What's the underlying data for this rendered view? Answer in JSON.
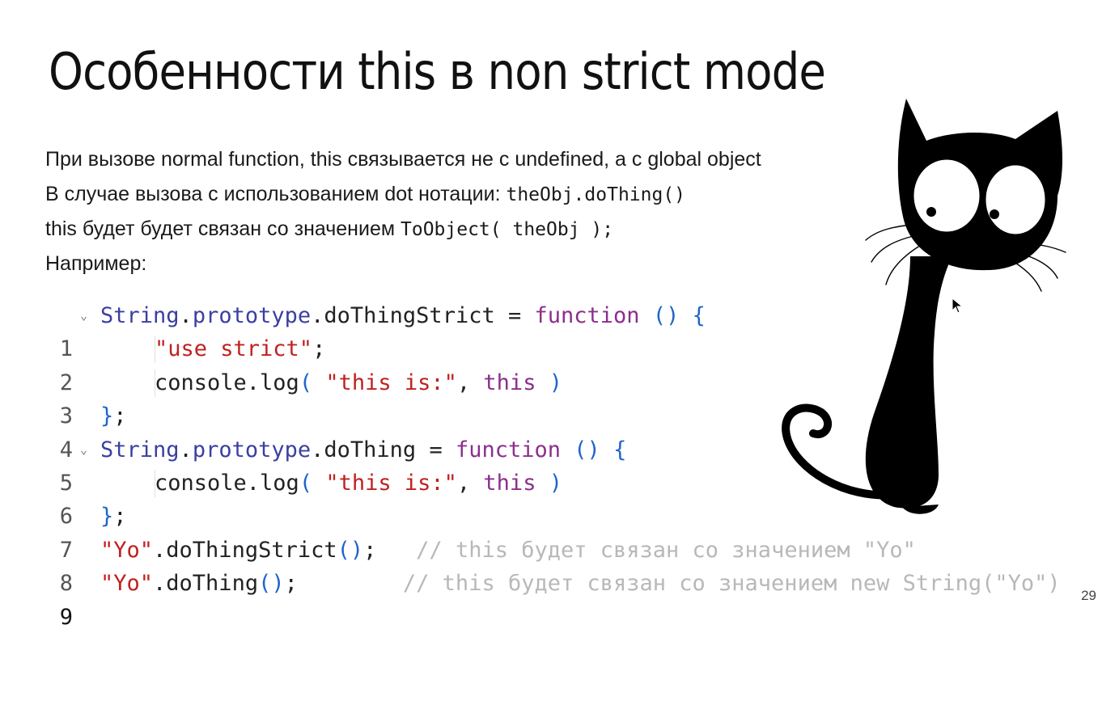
{
  "slide": {
    "title": "Особенности this в non strict mode",
    "page_number": "29"
  },
  "text": {
    "line1": "При вызове normal function, this связывается не с undefined, а с global object",
    "line2_prefix": "В случае вызова с использованием dot нотации: ",
    "line2_code": "theObj.doThing()",
    "line3_prefix": "this будет будет связан со значением ",
    "line3_code": "ToObject( theObj );",
    "line4": "Например:"
  },
  "code": {
    "line_numbers": [
      "1",
      "2",
      "3",
      "4",
      "5",
      "6",
      "7",
      "8",
      "9"
    ],
    "l1": {
      "obj": "String",
      "dot1": ".",
      "prop1": "prototype",
      "dot2": ".",
      "prop2": "doThingStrict",
      "eq": " = ",
      "kw": "function",
      "sp": " ",
      "parens": "()",
      "sp2": " ",
      "brace": "{"
    },
    "l2": {
      "str": "\"use strict\"",
      "semi": ";"
    },
    "l3": {
      "fn": "console.log",
      "open": "(",
      "sp": " ",
      "str": "\"this is:\"",
      "comma": ", ",
      "kw": "this",
      "sp2": " ",
      "close": ")"
    },
    "l4": {
      "brace": "}",
      "semi": ";"
    },
    "l5": {
      "obj": "String",
      "dot1": ".",
      "prop1": "prototype",
      "dot2": ".",
      "prop2": "doThing",
      "eq": " = ",
      "kw": "function",
      "sp": " ",
      "parens": "()",
      "sp2": " ",
      "brace": "{"
    },
    "l6": {
      "fn": "console.log",
      "open": "(",
      "sp": " ",
      "str": "\"this is:\"",
      "comma": ", ",
      "kw": "this",
      "sp2": " ",
      "close": ")"
    },
    "l7": {
      "brace": "}",
      "semi": ";"
    },
    "l8": {
      "str": "\"Yo\"",
      "call": ".doThingStrict",
      "parens": "()",
      "semi": ";",
      "pad": "   ",
      "comment": "// this будет связан со значением \"Yo\""
    },
    "l9": {
      "str": "\"Yo\"",
      "call": ".doThing",
      "parens": "()",
      "semi": ";",
      "pad": "        ",
      "comment": "// this будет связан со значением new String(\"Yo\")"
    }
  },
  "colors": {
    "keyword": "#8b2f8c",
    "string": "#c0211f",
    "bracket": "#1f65c9",
    "object": "#3b3fa0",
    "comment": "#b8b8b8"
  },
  "icons": [
    "fold-chevron-icon",
    "cat-illustration",
    "mouse-cursor-icon"
  ]
}
